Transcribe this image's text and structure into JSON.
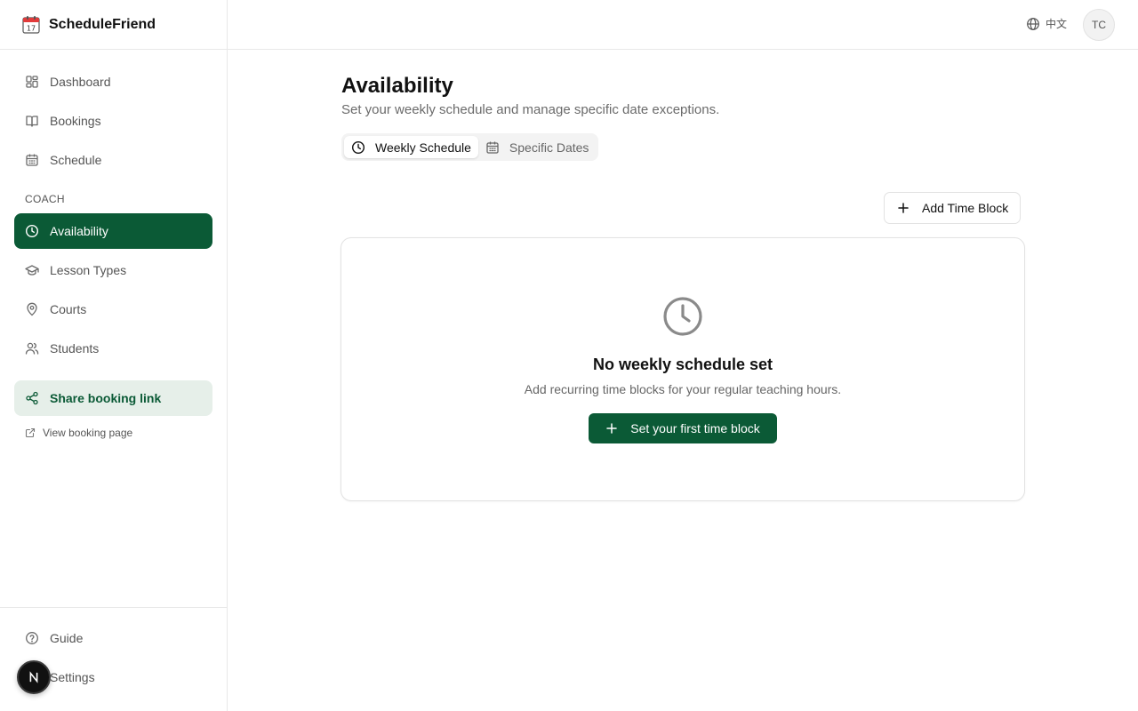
{
  "brand": {
    "name": "ScheduleFriend",
    "icon": "calendar-emoji-icon"
  },
  "sidebar": {
    "nav": [
      {
        "label": "Dashboard",
        "icon": "dashboard-icon"
      },
      {
        "label": "Bookings",
        "icon": "book-icon"
      },
      {
        "label": "Schedule",
        "icon": "calendar-icon"
      }
    ],
    "section_label": "COACH",
    "coach_nav": [
      {
        "label": "Availability",
        "icon": "clock-icon",
        "active": true
      },
      {
        "label": "Lesson Types",
        "icon": "graduation-cap-icon"
      },
      {
        "label": "Courts",
        "icon": "map-pin-icon"
      },
      {
        "label": "Students",
        "icon": "users-icon"
      }
    ],
    "share_label": "Share booking link",
    "view_page_label": "View booking page",
    "bottom": [
      {
        "label": "Guide",
        "icon": "help-circle-icon"
      },
      {
        "label": "Settings",
        "icon": "settings-icon"
      }
    ]
  },
  "topbar": {
    "language": "中文",
    "avatar_initials": "TC"
  },
  "main": {
    "title": "Availability",
    "subtitle": "Set your weekly schedule and manage specific date exceptions.",
    "tabs": [
      {
        "label": "Weekly Schedule",
        "icon": "clock-icon",
        "active": true
      },
      {
        "label": "Specific Dates",
        "icon": "calendar-icon",
        "active": false
      }
    ],
    "add_button": "Add Time Block",
    "empty": {
      "title": "No weekly schedule set",
      "description": "Add recurring time blocks for your regular teaching hours.",
      "button": "Set your first time block"
    }
  },
  "colors": {
    "accent": "#0b5a36",
    "accent_light": "#e6efe9"
  }
}
